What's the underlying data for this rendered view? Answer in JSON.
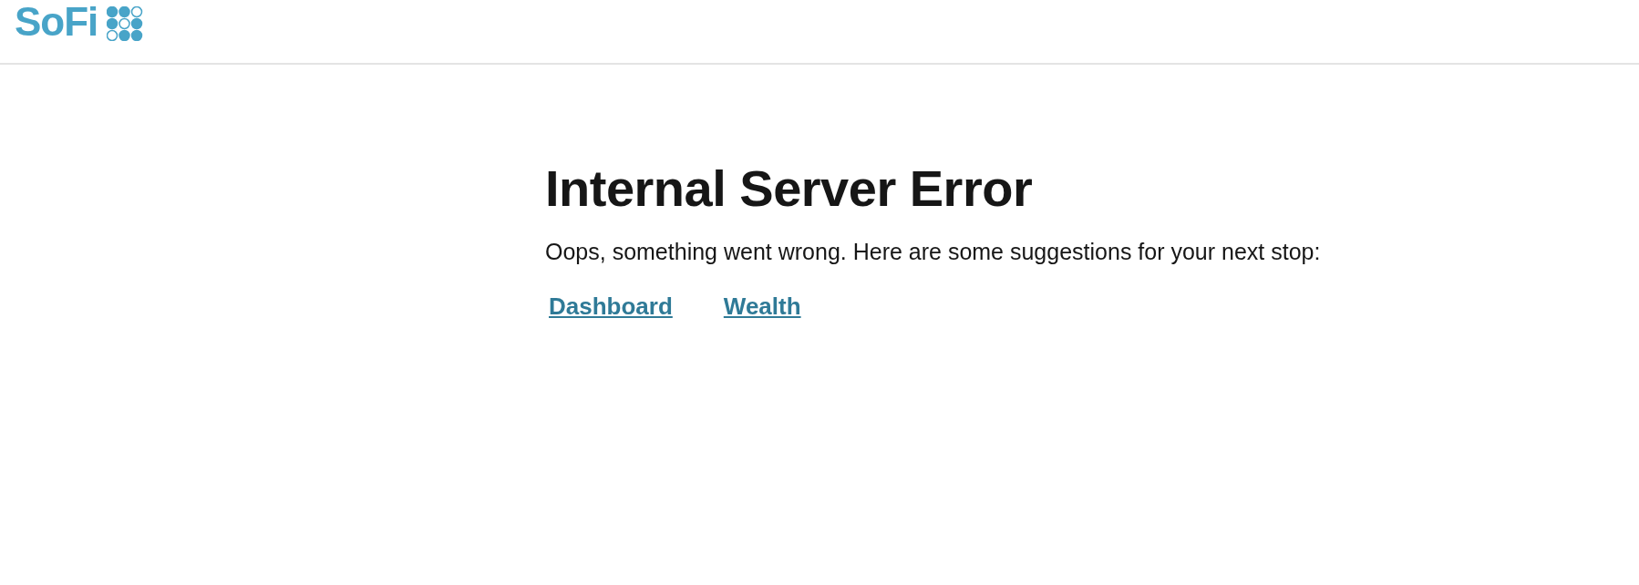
{
  "header": {
    "logo": "SoFi"
  },
  "error": {
    "title": "Internal Server Error",
    "message": "Oops, something went wrong. Here are some suggestions for your next stop:",
    "links": [
      {
        "label": "Dashboard"
      },
      {
        "label": "Wealth"
      }
    ]
  }
}
